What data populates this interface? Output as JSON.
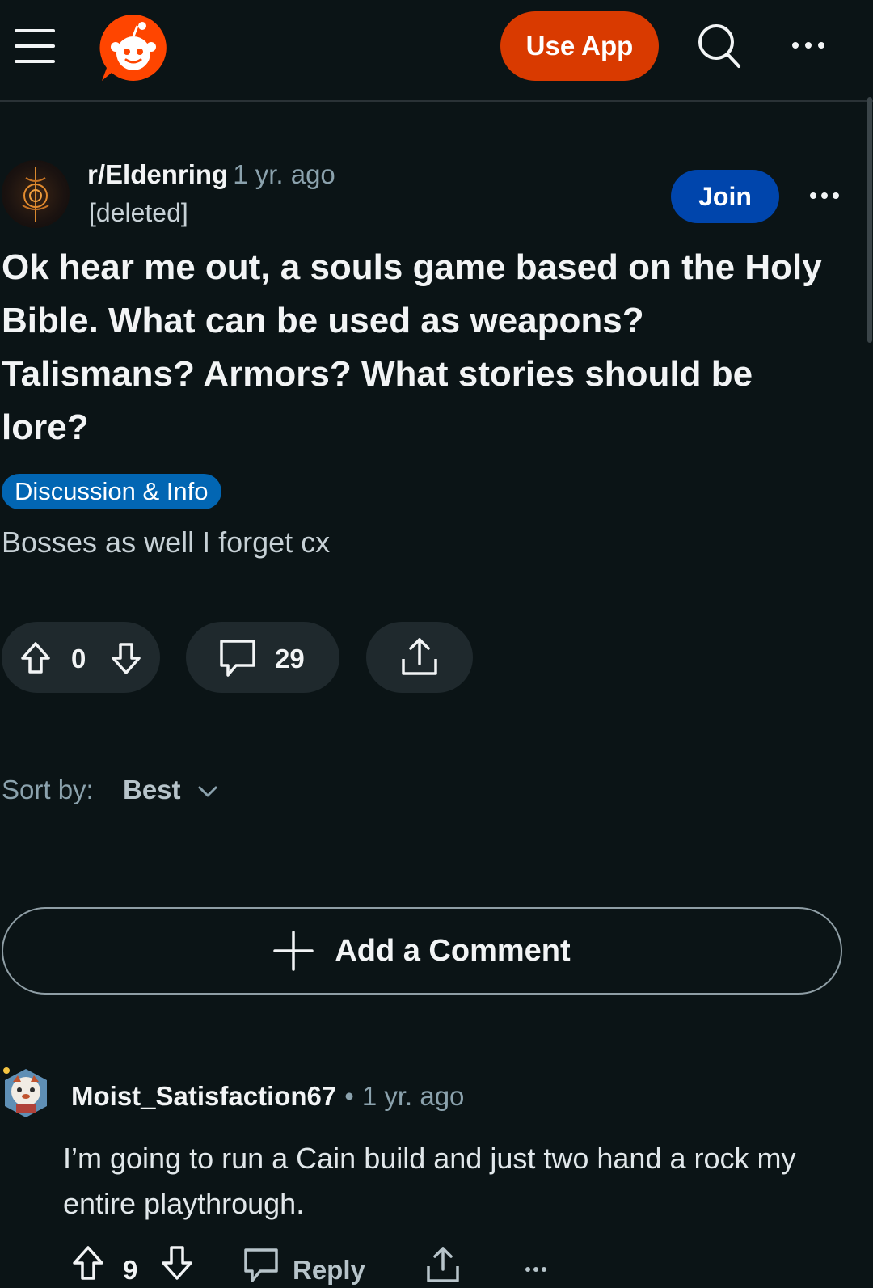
{
  "header": {
    "use_app_label": "Use App",
    "colors": {
      "background": "#0b1416",
      "brand_orange": "#ff4500",
      "use_app_bg": "#d93a00",
      "join_bg": "#0045ac",
      "flair_bg": "#0266b3"
    },
    "icons": [
      "menu-icon",
      "reddit-logo",
      "search-icon",
      "more-icon"
    ]
  },
  "post": {
    "subreddit": "r/Eldenring",
    "time": "1 yr. ago",
    "author": "[deleted]",
    "join_label": "Join",
    "title": "Ok hear me out, a souls game based on the Holy Bible. What can be used as weapons? Talismans? Armors? What stories should be lore?",
    "flair": "Discussion & Info",
    "body": "Bosses as well I forget cx",
    "votes": "0",
    "comments": "29"
  },
  "sort": {
    "label": "Sort by:",
    "value": "Best"
  },
  "add_comment": {
    "label": "Add a Comment"
  },
  "comment": {
    "user": "Moist_Satisfaction67",
    "separator": "•",
    "time": "1 yr. ago",
    "body": "I’m going to run a Cain build and just two hand a rock my entire playthrough.",
    "votes": "9",
    "reply_label": "Reply"
  }
}
